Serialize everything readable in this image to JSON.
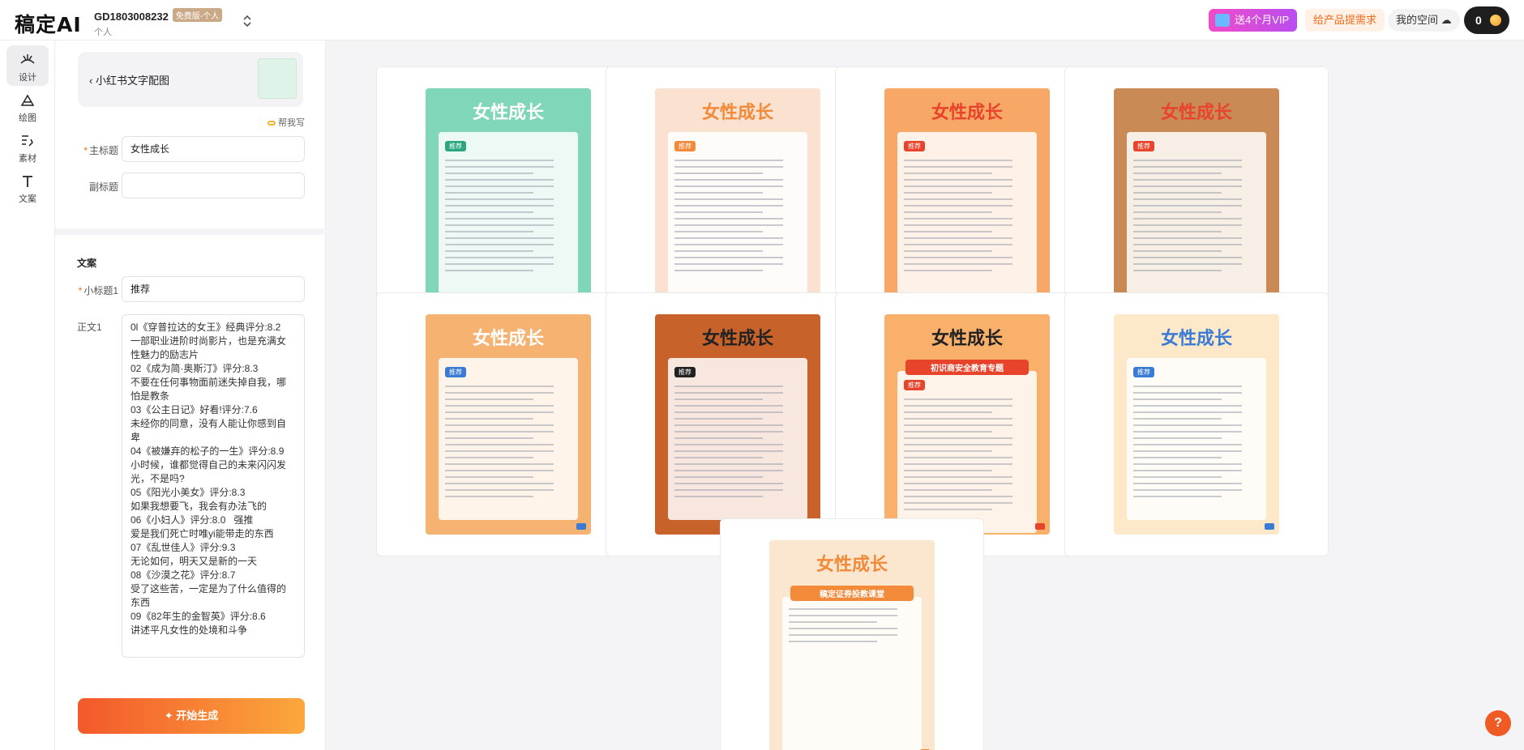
{
  "topbar": {
    "logo": "稿定AI",
    "account_id": "GD1803008232",
    "account_badge": "免费版-个人",
    "account_type": "个人",
    "vip_label": "送4个月VIP",
    "request_label": "给产品提需求",
    "space_label": "我的空间",
    "points": "0"
  },
  "nav": {
    "items": [
      {
        "label": "设计",
        "icon": "design-icon",
        "active": true
      },
      {
        "label": "绘图",
        "icon": "draw-icon",
        "active": false
      },
      {
        "label": "素材",
        "icon": "material-icon",
        "active": false
      },
      {
        "label": "文案",
        "icon": "text-icon",
        "active": false
      }
    ]
  },
  "panel": {
    "template_name": "小红书文字配图",
    "help_label": "帮我写",
    "title_label": "主标题",
    "title_value": "女性成长",
    "subtitle_label": "副标题",
    "subtitle_value": "",
    "section_label": "文案",
    "subheading_label": "小标题1",
    "subheading_value": "推荐",
    "body_label": "正文1",
    "body_lines": [
      "0l《穿普拉达的女王》经典评分:8.2",
      "一部职业进阶时尚影片，也是充满女",
      "性魅力的励志片",
      "02《成为简·奥斯汀》评分:8.3",
      "不要在任何事物面前迷失掉自我，哪",
      "怕是教条",
      "03《公主日记》好看!评分:7.6",
      "未经你的同意，没有人能让你感到自",
      "卑",
      "04《被嫌弃的松子的一生》评分:8.9",
      "小时候，谁都觉得自己的未来闪闪发",
      "光，不是吗?",
      "05《阳光小美女》评分:8.3",
      "如果我想要飞，我会有办法飞的",
      "06《小妇人》评分:8.0   强推",
      "爱是我们死亡时唯yi能带走的东西",
      "07《乱世佳人》评分:9.3",
      "无论如何，明天又是新的一天",
      "08《沙漠之花》评分:8.7",
      "受了这些苦，一定是为了什么值得的",
      "东西",
      "09《82年生的金智英》评分:8.6",
      "讲述平凡女性的处境和斗争"
    ],
    "generate_label": "开始生成"
  },
  "gallery": {
    "posters": [
      {
        "title": "女性成长",
        "tag": "推荐",
        "bg": "#7fd6b8",
        "accent": "#2aa77f",
        "title_color": "#ffffff"
      },
      {
        "title": "女性成长",
        "tag": "推荐",
        "bg": "#fbe1cf",
        "accent": "#f28a3a",
        "title_color": "#f28a3a"
      },
      {
        "title": "女性成长",
        "tag": "推荐",
        "bg": "#f7a867",
        "accent": "#e8432b",
        "title_color": "#e8432b"
      },
      {
        "title": "女性成长",
        "tag": "推荐",
        "bg": "#c98a55",
        "accent": "#e8432b",
        "title_color": "#e8432b"
      },
      {
        "title": "女性成长",
        "tag": "推荐",
        "bg": "#f5b271",
        "accent": "#3a7bd5",
        "title_color": "#ffffff"
      },
      {
        "title": "女性成长",
        "tag": "推荐",
        "bg": "#c7622a",
        "accent": "#222222",
        "title_color": "#222222"
      },
      {
        "title": "女性成长",
        "tag": "推荐",
        "bg": "#f9b06a",
        "accent": "#e8432b",
        "title_color": "#222222",
        "subtitle": "初识商安全教育专题"
      },
      {
        "title": "女性成长",
        "tag": "推荐",
        "bg": "#fde9c9",
        "accent": "#3a7bd5",
        "title_color": "#3a7bd5"
      },
      {
        "title": "女性成长",
        "tag": "",
        "bg": "#fbe6cf",
        "accent": "#f28a3a",
        "title_color": "#f28a3a",
        "subtitle": "稿定证券投教课堂"
      }
    ]
  },
  "help_fab": "?"
}
